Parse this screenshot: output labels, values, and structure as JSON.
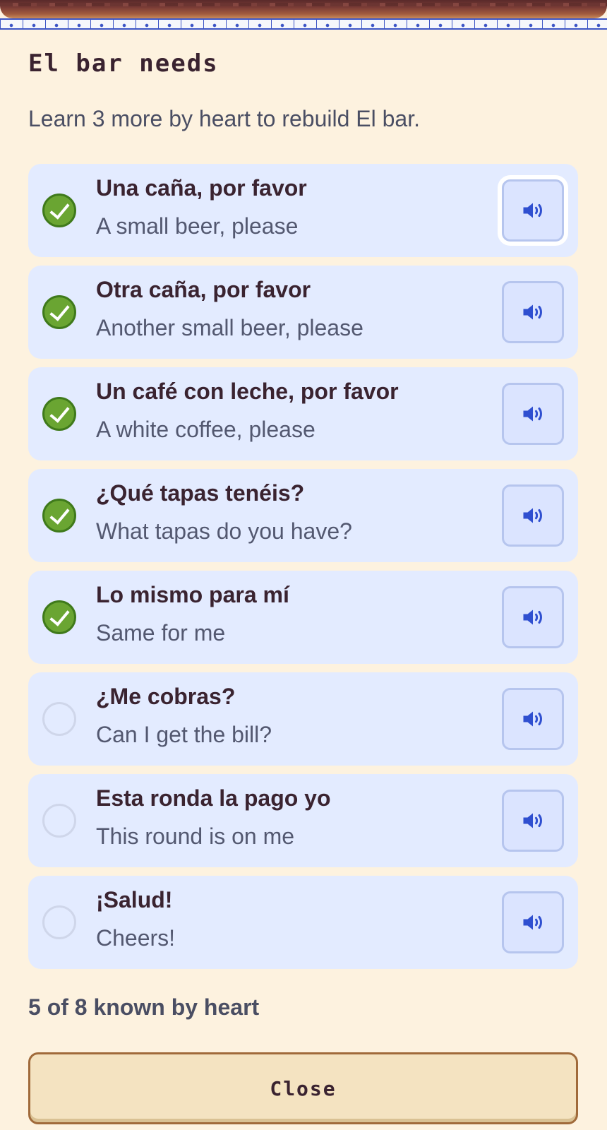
{
  "modal": {
    "title": "El bar needs",
    "subtitle": "Learn 3 more by heart to rebuild El bar."
  },
  "phrases": [
    {
      "phrase": "Una caña, por favor",
      "translation": "A small beer, please",
      "known": true
    },
    {
      "phrase": "Otra caña, por favor",
      "translation": "Another small beer, please",
      "known": true
    },
    {
      "phrase": "Un café con leche, por favor",
      "translation": "A white coffee, please",
      "known": true
    },
    {
      "phrase": "¿Qué tapas tenéis?",
      "translation": "What tapas do you have?",
      "known": true
    },
    {
      "phrase": "Lo mismo para mí",
      "translation": "Same for me",
      "known": true
    },
    {
      "phrase": "¿Me cobras?",
      "translation": "Can I get the bill?",
      "known": false
    },
    {
      "phrase": "Esta ronda la pago yo",
      "translation": "This round is on me",
      "known": false
    },
    {
      "phrase": "¡Salud!",
      "translation": "Cheers!",
      "known": false
    }
  ],
  "footer": {
    "progress_text": "5 of 8 known by heart",
    "close_label": "Close"
  },
  "icons": {
    "known": "checkmark-circle-icon",
    "unknown": "empty-circle-icon",
    "audio": "speaker-icon"
  },
  "colors": {
    "background": "#fdf2df",
    "row": "#e3ebff",
    "check_green": "#6aa532",
    "speaker_blue": "#2f4fd0",
    "close_button": "#f4e3c1"
  }
}
